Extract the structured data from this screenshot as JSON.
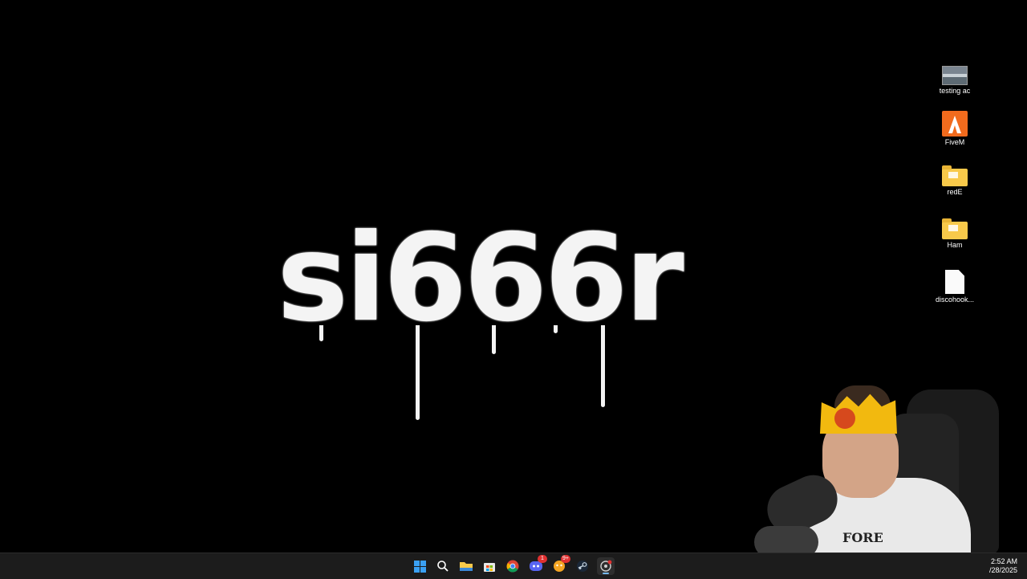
{
  "wallpaper": {
    "text": "si666r"
  },
  "desktop_icons": [
    {
      "label": "testing ac",
      "icon": "image-file-icon"
    },
    {
      "label": "FiveM",
      "icon": "fivem-app-icon"
    },
    {
      "label": "redE",
      "icon": "folder-icon"
    },
    {
      "label": "Ham",
      "icon": "folder-icon"
    },
    {
      "label": "discohook...",
      "icon": "document-icon"
    }
  ],
  "taskbar": {
    "items": [
      {
        "name": "start",
        "icon": "windows-start-icon"
      },
      {
        "name": "search",
        "icon": "search-icon"
      },
      {
        "name": "file-explorer",
        "icon": "folder-icon"
      },
      {
        "name": "microsoft-store",
        "icon": "store-icon"
      },
      {
        "name": "chrome",
        "icon": "chrome-icon"
      },
      {
        "name": "discord",
        "icon": "discord-icon",
        "badge": "1"
      },
      {
        "name": "notifications-app",
        "icon": "chat-app-icon",
        "badge": "9+"
      },
      {
        "name": "steam",
        "icon": "steam-icon"
      },
      {
        "name": "recording-app",
        "icon": "record-icon"
      }
    ],
    "clock": {
      "time": "2:52 AM",
      "date": "/28/2025"
    }
  },
  "webcam": {
    "shirt_text": "FORE"
  },
  "colors": {
    "taskbar_bg": "#1c1c1c",
    "accent": "#3aa0f3",
    "badge": "#e03131"
  }
}
